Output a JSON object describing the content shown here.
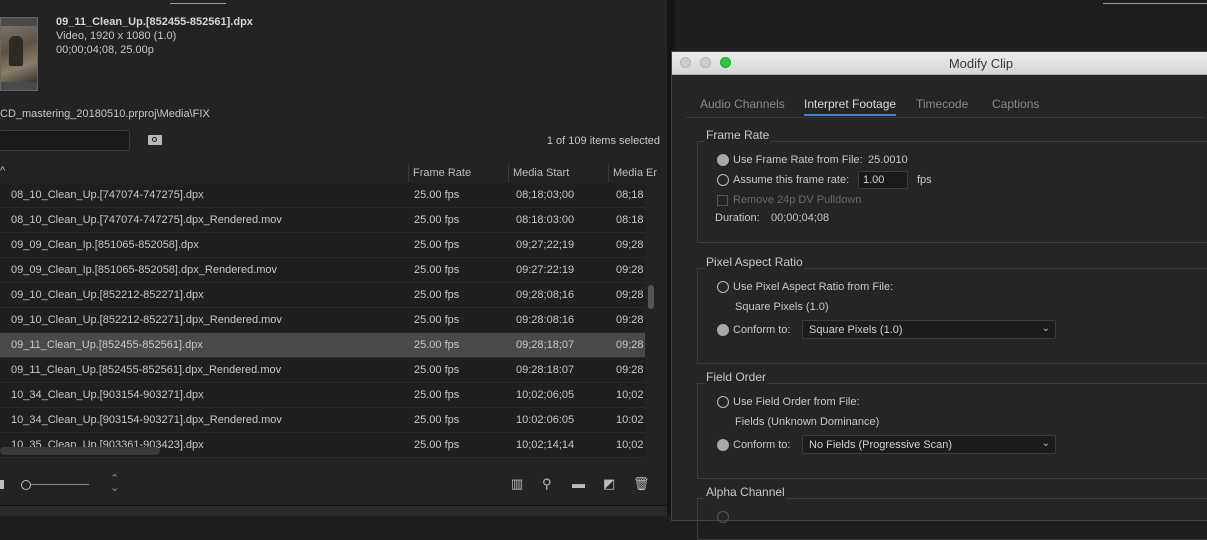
{
  "project": {
    "clip_name": "09_11_Clean_Up.[852455-852561].dpx",
    "clip_info_line1": "Video, 1920 x 1080 (1.0)",
    "clip_info_line2": "00;00;04;08, 25.00p",
    "path": "CD_mastering_20180510.prproj\\Media\\FIX",
    "items_selected": "1 of 109 items selected",
    "columns": [
      "Frame Rate",
      "Media Start",
      "Media En"
    ],
    "rows": [
      {
        "name": "08_10_Clean_Up.[747074-747275].dpx",
        "fps": "25.00 fps",
        "start": "08;18;03;00",
        "end": "08;18;"
      },
      {
        "name": "08_10_Clean_Up.[747074-747275].dpx_Rendered.mov",
        "fps": "25.00 fps",
        "start": "08:18:03:00",
        "end": "08:18:"
      },
      {
        "name": "09_09_Clean_Ip.[851065-852058].dpx",
        "fps": "25.00 fps",
        "start": "09;27;22;19",
        "end": "09;28;"
      },
      {
        "name": "09_09_Clean_Ip.[851065-852058].dpx_Rendered.mov",
        "fps": "25.00 fps",
        "start": "09:27:22:19",
        "end": "09:28:"
      },
      {
        "name": "09_10_Clean_Up.[852212-852271].dpx",
        "fps": "25.00 fps",
        "start": "09;28;08;16",
        "end": "09;28;"
      },
      {
        "name": "09_10_Clean_Up.[852212-852271].dpx_Rendered.mov",
        "fps": "25.00 fps",
        "start": "09:28:08:16",
        "end": "09:28:"
      },
      {
        "name": "09_11_Clean_Up.[852455-852561].dpx",
        "fps": "25.00 fps",
        "start": "09;28;18;07",
        "end": "09;28;"
      },
      {
        "name": "09_11_Clean_Up.[852455-852561].dpx_Rendered.mov",
        "fps": "25.00 fps",
        "start": "09:28:18:07",
        "end": "09:28:"
      },
      {
        "name": "10_34_Clean_Up.[903154-903271].dpx",
        "fps": "25.00 fps",
        "start": "10;02;06;05",
        "end": "10;02;"
      },
      {
        "name": "10_34_Clean_Up.[903154-903271].dpx_Rendered.mov",
        "fps": "25.00 fps",
        "start": "10:02:06:05",
        "end": "10:02:"
      },
      {
        "name": "10_35_Clean_Up.[903361-903423].dpx",
        "fps": "25.00 fps",
        "start": "10;02;14;14",
        "end": "10;02;"
      }
    ],
    "selected_row": 6
  },
  "dialog": {
    "title": "Modify Clip",
    "tabs": [
      "Audio Channels",
      "Interpret Footage",
      "Timecode",
      "Captions"
    ],
    "active_tab": 1,
    "frame_rate": {
      "label": "Frame Rate",
      "use_file_label": "Use Frame Rate from File:",
      "file_value": "25.0010",
      "assume_label": "Assume this frame rate:",
      "assume_value": "1.00",
      "fps_unit": "fps",
      "pulldown_label": "Remove 24p DV Pulldown",
      "duration_label": "Duration:",
      "duration_value": "00;00;04;08"
    },
    "pixel_aspect": {
      "label": "Pixel Aspect Ratio",
      "use_file_label": "Use Pixel Aspect Ratio from File:",
      "file_value": "Square Pixels (1.0)",
      "conform_label": "Conform to:",
      "conform_value": "Square Pixels (1.0)"
    },
    "field_order": {
      "label": "Field Order",
      "use_file_label": "Use Field Order from File:",
      "file_value": "Fields (Unknown Dominance)",
      "conform_label": "Conform to:",
      "conform_value": "No Fields (Progressive Scan)"
    },
    "alpha_channel": {
      "label": "Alpha Channel"
    }
  }
}
